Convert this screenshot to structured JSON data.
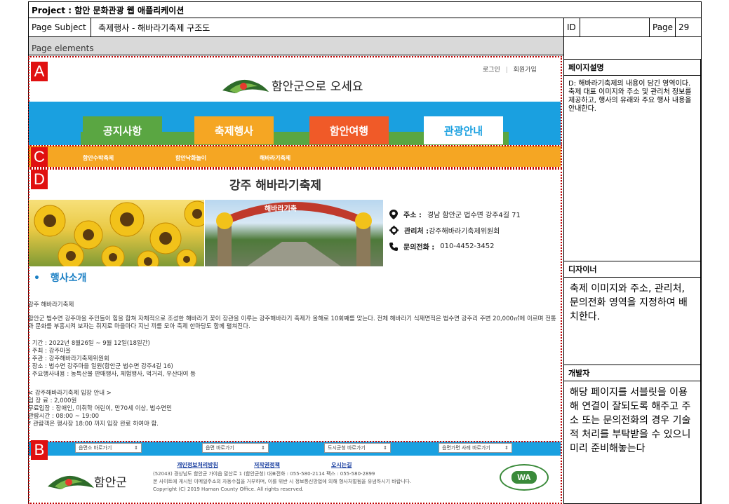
{
  "header": {
    "project": "Project : 함안 문화관광 웹 애플리케이션",
    "page_subject_label": "Page Subject",
    "page_subject": "축제행사 - 해바라기축제 구조도",
    "id_label": "ID",
    "id_value": "",
    "page_label": "Page",
    "page_number": "29",
    "page_elements": "Page elements"
  },
  "markers": {
    "a": "A",
    "b": "B",
    "c": "C",
    "d": "D"
  },
  "site": {
    "login": "로그인",
    "join": "회원가입",
    "logo_text": "함안군으로 오세요",
    "nav": [
      {
        "label": "공지사항",
        "color": "#5aa642"
      },
      {
        "label": "축제행사",
        "color": "#f5a623"
      },
      {
        "label": "함안여행",
        "color": "#f05a28"
      },
      {
        "label": "관광안내",
        "color": "#ffffff"
      }
    ],
    "subnav": [
      "함안수박축제",
      "함안낙화놀이",
      "해바라기축제"
    ],
    "title": "강주 해바라기축제",
    "gate_sign": "해바라기축",
    "info": {
      "address_label": "주소 :",
      "address": "경남 함안군 법수면 강주4길 71",
      "org_label": "관리처 :",
      "org": "강주해바라기축제위원회",
      "phone_label": "문의전화 :",
      "phone": "010-4452-3452"
    },
    "section_title": "행사소개",
    "intro_name": "강주 해바라기축제",
    "intro_text": "함안군 법수면 강주마을 주민들이 힘을 합쳐 자체적으로 조성한 해바라기 꽃이 장관을 이루는 강주해바라기 축제가 올해로 10회째를 맞는다. 전체 해바라기 식재면적은 법수면 강주리 주변 20,000㎡에 이르며 전통과 문화를 부흥시켜 보자는 취지로 마을마다 지닌 끼를 모아 축제 한마당도 함께 펼쳐진다.",
    "details": [
      "- 기간 : 2022년 8월26일 ~ 9월 12일(18일간)",
      "- 주최 : 강주마을",
      "- 주관 : 강주해바라기축제위원회",
      "- 장소 : 법수면 강주마을 일원(함안군 법수면 강주4길 16)",
      "- 주요행사내용 : 농특산물 판매행사, 체험행사, 먹거리, 우산대여 등"
    ],
    "entry_title": "< 강주해바라기축제 입장 안내 >",
    "entry": [
      "입 장 료 : 2,000원",
      "무료입장 : 장애인, 미취학 어린이, 만70세 이상, 법수면민",
      "관람시간 : 08:00 ~ 19:00",
      "* 관람객은 행사장 18:00 까지 입장 완료 하여야 함."
    ],
    "footer_selects": [
      "읍면소 바로가기",
      "읍면 바로가기",
      "도시군청 바로가기",
      "읍면가면 사례 바로가기"
    ],
    "footer_links": [
      "개인정보처리방침",
      "저작권정책",
      "오시는길"
    ],
    "footer_logo": "함안군",
    "footer_address": "(52043) 경상남도 함안군 가야읍 말산로 1 (함안군청)    대표전화 : 055-580-2114    팩스 : 055-580-2899",
    "footer_notice": "본 사이트에 게시된 이메일주소의 자동수집을 거부하며, 이를 위반 시 정보통신망법에 의해 형사처벌됨을 유념하시기 바랍니다.",
    "footer_copy": "Copyright (C) 2019 Haman County Office. All rights reserved.",
    "wa_badge": "WA"
  },
  "side": {
    "desc_head": "페이지설명",
    "desc": "D: 해바라기축제의 내용이 담긴 영역이다. 축제 대표 이미지와 주소 및 관리처 정보를 제공하고, 행사의 유래와 주요 행사 내용을 안내한다.",
    "designer_head": "디자이너",
    "designer": "축제 이미지와 주소, 관리처, 문의전화 영역을 지정하여 배치한다.",
    "dev_head": "개발자",
    "dev": "해당 페이지를 서블릿을 이용해 연결이 잘되도록 해주고 주소 또는 문의전화의 경우 기술적 처리를 부탁받을 수 있으니 미리 준비해놓는다"
  },
  "colors": {
    "blue": "#1aa0e0",
    "orange": "#f5a623",
    "marker": "#e01010"
  }
}
